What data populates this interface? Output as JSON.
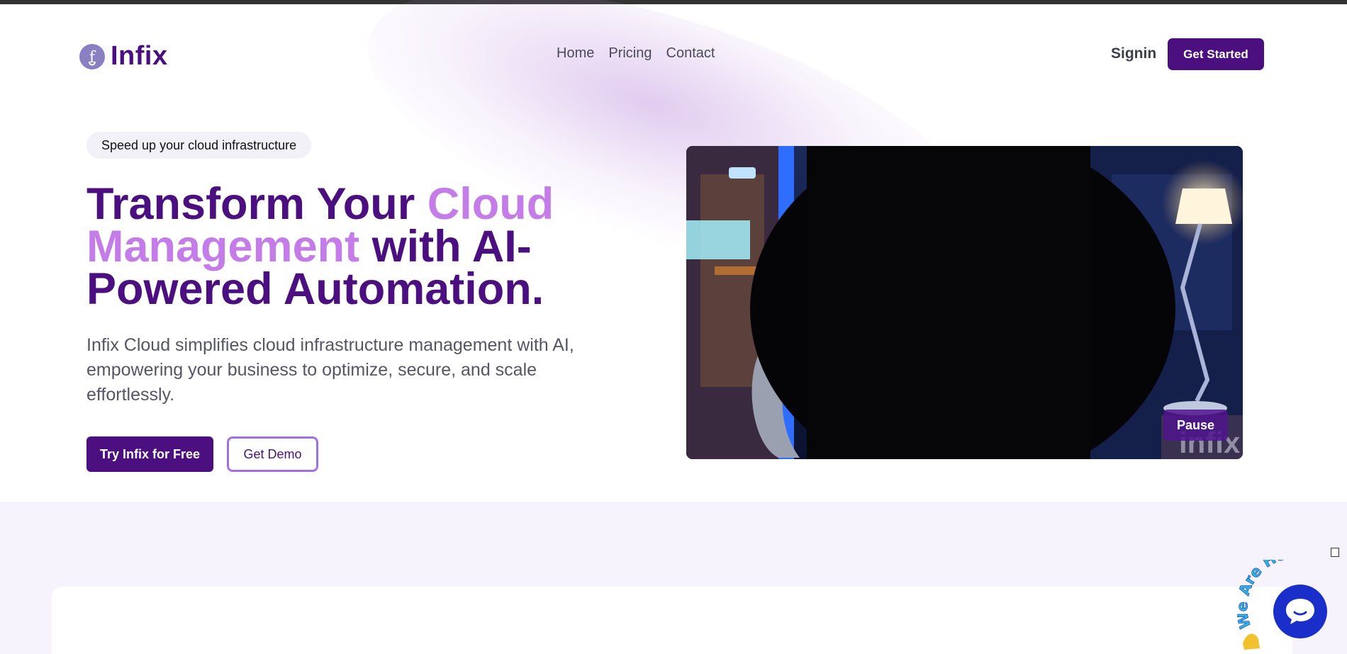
{
  "brand": {
    "name": "Infix"
  },
  "nav": {
    "items": [
      {
        "label": "Home"
      },
      {
        "label": "Pricing"
      },
      {
        "label": "Contact"
      }
    ]
  },
  "header": {
    "signin_label": "Signin",
    "get_started_label": "Get Started"
  },
  "hero": {
    "pill": "Speed up your cloud infrastructure",
    "title_part1": "Transform Your ",
    "title_accent": "Cloud Management",
    "title_part2": " with AI-Powered Automation.",
    "description": "Infix Cloud simplifies cloud infrastructure management with AI, empowering your business to optimize, secure, and scale effortlessly.",
    "primary_cta": "Try Infix for Free",
    "secondary_cta": "Get Demo"
  },
  "video": {
    "pause_label": "Pause",
    "watermark": "infix"
  },
  "chat_widget": {
    "badge_text": "We Are Here!"
  },
  "colors": {
    "brand_purple": "#4b0f7f",
    "accent_pink": "#c47ce8",
    "chat_blue": "#1a2fc9"
  }
}
